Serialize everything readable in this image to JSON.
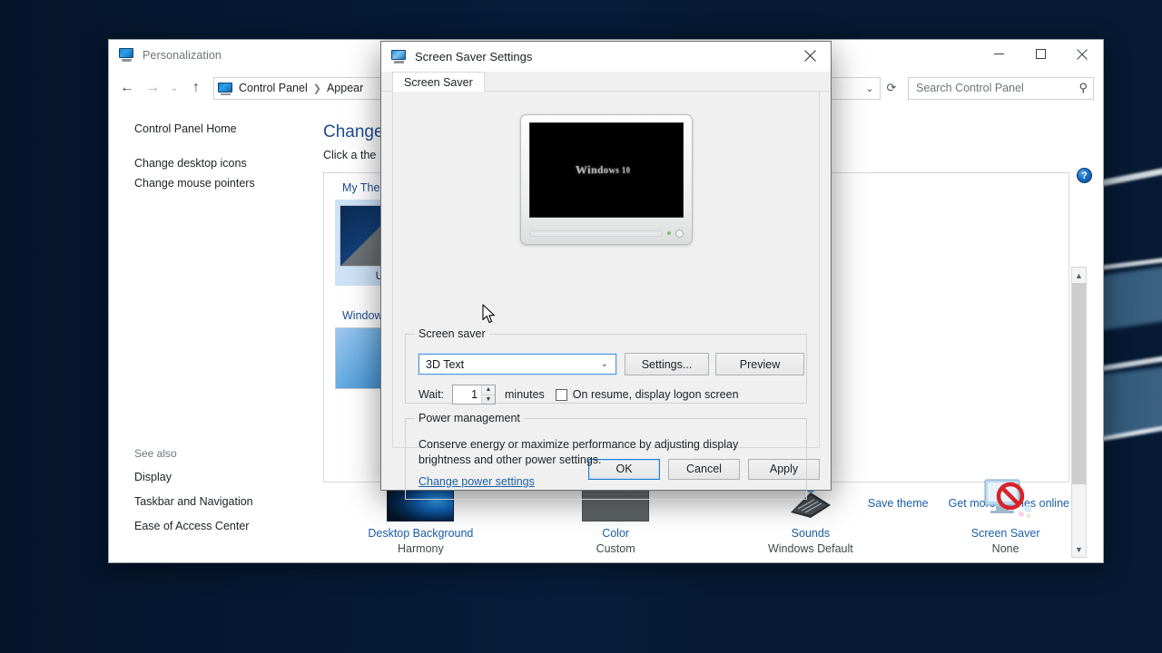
{
  "control_panel": {
    "title": "Personalization",
    "breadcrumb": [
      "Control Panel",
      "Appear"
    ],
    "search_placeholder": "Search Control Panel",
    "window_buttons": {
      "minimize": "minimize-icon",
      "maximize": "maximize-icon",
      "close": "close-icon"
    },
    "sidebar": {
      "home": "Control Panel Home",
      "links": [
        "Change desktop icons",
        "Change mouse pointers"
      ],
      "see_also_title": "See also",
      "see_also_links": [
        "Display",
        "Taskbar and Navigation",
        "Ease of Access Center"
      ]
    },
    "main": {
      "heading": "Change",
      "subheading": "Click a the",
      "group_label": "My Them",
      "tile_caption": "Uns",
      "group_label_2": "Windows",
      "links": [
        "Save theme",
        "Get more themes online"
      ],
      "help": "?"
    },
    "bottom_items": [
      {
        "title": "Desktop Background",
        "value": "Harmony",
        "icon": "wallpaper-thumbnail"
      },
      {
        "title": "Color",
        "value": "Custom",
        "icon": "color-swatch-thumbnail"
      },
      {
        "title": "Sounds",
        "value": "Windows Default",
        "icon": "speaker-icon"
      },
      {
        "title": "Screen Saver",
        "value": "None",
        "icon": "screen-saver-disabled-icon"
      }
    ]
  },
  "dialog": {
    "title": "Screen Saver Settings",
    "close_label": "✕",
    "tabs": [
      {
        "label": "Screen Saver",
        "active": true
      }
    ],
    "preview": {
      "screen_text": "Windows 10"
    },
    "screen_saver_group": {
      "legend": "Screen saver",
      "selected": "3D Text",
      "dropdown_arrow": "⌄",
      "settings_button": "Settings...",
      "preview_button": "Preview",
      "wait_label": "Wait:",
      "wait_value": "1",
      "minutes_label": "minutes",
      "logon_checkbox_label": "On resume, display logon screen",
      "logon_checked": false
    },
    "power_group": {
      "legend": "Power management",
      "description": "Conserve energy or maximize performance by adjusting display brightness and other power settings.",
      "link": "Change power settings"
    },
    "footer_buttons": {
      "ok": "OK",
      "cancel": "Cancel",
      "apply": "Apply"
    }
  },
  "colors": {
    "accent_blue": "#1b5fa8",
    "heading_blue": "#1b4d91",
    "focus_blue": "#1a7ad4",
    "desktop_dark": "#04142b"
  }
}
